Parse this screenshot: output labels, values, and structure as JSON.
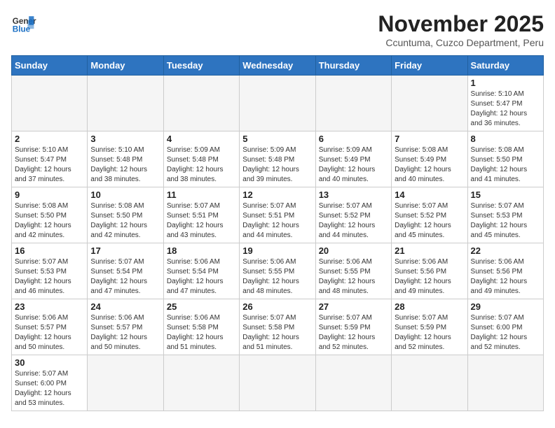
{
  "header": {
    "logo_general": "General",
    "logo_blue": "Blue",
    "month_title": "November 2025",
    "subtitle": "Ccuntuma, Cuzco Department, Peru"
  },
  "weekdays": [
    "Sunday",
    "Monday",
    "Tuesday",
    "Wednesday",
    "Thursday",
    "Friday",
    "Saturday"
  ],
  "weeks": [
    [
      {
        "day": "",
        "info": ""
      },
      {
        "day": "",
        "info": ""
      },
      {
        "day": "",
        "info": ""
      },
      {
        "day": "",
        "info": ""
      },
      {
        "day": "",
        "info": ""
      },
      {
        "day": "",
        "info": ""
      },
      {
        "day": "1",
        "info": "Sunrise: 5:10 AM\nSunset: 5:47 PM\nDaylight: 12 hours\nand 36 minutes."
      }
    ],
    [
      {
        "day": "2",
        "info": "Sunrise: 5:10 AM\nSunset: 5:47 PM\nDaylight: 12 hours\nand 37 minutes."
      },
      {
        "day": "3",
        "info": "Sunrise: 5:10 AM\nSunset: 5:48 PM\nDaylight: 12 hours\nand 38 minutes."
      },
      {
        "day": "4",
        "info": "Sunrise: 5:09 AM\nSunset: 5:48 PM\nDaylight: 12 hours\nand 38 minutes."
      },
      {
        "day": "5",
        "info": "Sunrise: 5:09 AM\nSunset: 5:48 PM\nDaylight: 12 hours\nand 39 minutes."
      },
      {
        "day": "6",
        "info": "Sunrise: 5:09 AM\nSunset: 5:49 PM\nDaylight: 12 hours\nand 40 minutes."
      },
      {
        "day": "7",
        "info": "Sunrise: 5:08 AM\nSunset: 5:49 PM\nDaylight: 12 hours\nand 40 minutes."
      },
      {
        "day": "8",
        "info": "Sunrise: 5:08 AM\nSunset: 5:50 PM\nDaylight: 12 hours\nand 41 minutes."
      }
    ],
    [
      {
        "day": "9",
        "info": "Sunrise: 5:08 AM\nSunset: 5:50 PM\nDaylight: 12 hours\nand 42 minutes."
      },
      {
        "day": "10",
        "info": "Sunrise: 5:08 AM\nSunset: 5:50 PM\nDaylight: 12 hours\nand 42 minutes."
      },
      {
        "day": "11",
        "info": "Sunrise: 5:07 AM\nSunset: 5:51 PM\nDaylight: 12 hours\nand 43 minutes."
      },
      {
        "day": "12",
        "info": "Sunrise: 5:07 AM\nSunset: 5:51 PM\nDaylight: 12 hours\nand 44 minutes."
      },
      {
        "day": "13",
        "info": "Sunrise: 5:07 AM\nSunset: 5:52 PM\nDaylight: 12 hours\nand 44 minutes."
      },
      {
        "day": "14",
        "info": "Sunrise: 5:07 AM\nSunset: 5:52 PM\nDaylight: 12 hours\nand 45 minutes."
      },
      {
        "day": "15",
        "info": "Sunrise: 5:07 AM\nSunset: 5:53 PM\nDaylight: 12 hours\nand 45 minutes."
      }
    ],
    [
      {
        "day": "16",
        "info": "Sunrise: 5:07 AM\nSunset: 5:53 PM\nDaylight: 12 hours\nand 46 minutes."
      },
      {
        "day": "17",
        "info": "Sunrise: 5:07 AM\nSunset: 5:54 PM\nDaylight: 12 hours\nand 47 minutes."
      },
      {
        "day": "18",
        "info": "Sunrise: 5:06 AM\nSunset: 5:54 PM\nDaylight: 12 hours\nand 47 minutes."
      },
      {
        "day": "19",
        "info": "Sunrise: 5:06 AM\nSunset: 5:55 PM\nDaylight: 12 hours\nand 48 minutes."
      },
      {
        "day": "20",
        "info": "Sunrise: 5:06 AM\nSunset: 5:55 PM\nDaylight: 12 hours\nand 48 minutes."
      },
      {
        "day": "21",
        "info": "Sunrise: 5:06 AM\nSunset: 5:56 PM\nDaylight: 12 hours\nand 49 minutes."
      },
      {
        "day": "22",
        "info": "Sunrise: 5:06 AM\nSunset: 5:56 PM\nDaylight: 12 hours\nand 49 minutes."
      }
    ],
    [
      {
        "day": "23",
        "info": "Sunrise: 5:06 AM\nSunset: 5:57 PM\nDaylight: 12 hours\nand 50 minutes."
      },
      {
        "day": "24",
        "info": "Sunrise: 5:06 AM\nSunset: 5:57 PM\nDaylight: 12 hours\nand 50 minutes."
      },
      {
        "day": "25",
        "info": "Sunrise: 5:06 AM\nSunset: 5:58 PM\nDaylight: 12 hours\nand 51 minutes."
      },
      {
        "day": "26",
        "info": "Sunrise: 5:07 AM\nSunset: 5:58 PM\nDaylight: 12 hours\nand 51 minutes."
      },
      {
        "day": "27",
        "info": "Sunrise: 5:07 AM\nSunset: 5:59 PM\nDaylight: 12 hours\nand 52 minutes."
      },
      {
        "day": "28",
        "info": "Sunrise: 5:07 AM\nSunset: 5:59 PM\nDaylight: 12 hours\nand 52 minutes."
      },
      {
        "day": "29",
        "info": "Sunrise: 5:07 AM\nSunset: 6:00 PM\nDaylight: 12 hours\nand 52 minutes."
      }
    ],
    [
      {
        "day": "30",
        "info": "Sunrise: 5:07 AM\nSunset: 6:00 PM\nDaylight: 12 hours\nand 53 minutes."
      },
      {
        "day": "",
        "info": ""
      },
      {
        "day": "",
        "info": ""
      },
      {
        "day": "",
        "info": ""
      },
      {
        "day": "",
        "info": ""
      },
      {
        "day": "",
        "info": ""
      },
      {
        "day": "",
        "info": ""
      }
    ]
  ]
}
